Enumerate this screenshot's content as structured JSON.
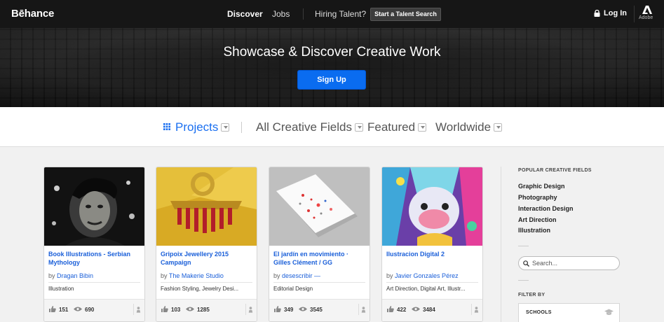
{
  "topnav": {
    "logo": "Bēhance",
    "discover": "Discover",
    "jobs": "Jobs",
    "hiring": "Hiring Talent?",
    "talent_search": "Start a Talent Search",
    "login": "Log In",
    "adobe": "Adobe",
    "icons": {
      "lock": "lock-icon",
      "adobe": "adobe-logo-icon"
    }
  },
  "hero": {
    "title": "Showcase & Discover Creative Work",
    "signup": "Sign Up",
    "accent": "#0a6cf0"
  },
  "filters": {
    "projects": "Projects",
    "fields": "All Creative Fields",
    "featured": "Featured",
    "location": "Worldwide",
    "active_color": "#1a6ff0"
  },
  "cards": [
    {
      "title": "Book Illustrations - Serbian Mythology",
      "by": "by",
      "owner": "Dragan Bibin",
      "fields": "Illustration",
      "likes": "151",
      "views": "690"
    },
    {
      "title": "Gripoix Jewellery 2015 Campaign",
      "by": "by",
      "owner": "The Makerie Studio",
      "fields": "Fashion Styling, Jewelry Desi...",
      "likes": "103",
      "views": "1285"
    },
    {
      "title": "El jardín en movimiento · Gilles Clément / GG",
      "by": "by",
      "owner": "desescribir —",
      "fields": "Editorial Design",
      "likes": "349",
      "views": "3545"
    },
    {
      "title": "Ilustracion Digital 2",
      "by": "by",
      "owner": "Javier Gonzales Pérez",
      "fields": "Art Direction, Digital Art, Illustr...",
      "likes": "422",
      "views": "3484"
    }
  ],
  "sidebar": {
    "popular_heading": "POPULAR CREATIVE FIELDS",
    "fields": [
      "Graphic Design",
      "Photography",
      "Interaction Design",
      "Art Direction",
      "Illustration"
    ],
    "search_placeholder": "Search...",
    "filter_heading": "FILTER BY",
    "schools": "SCHOOLS"
  }
}
